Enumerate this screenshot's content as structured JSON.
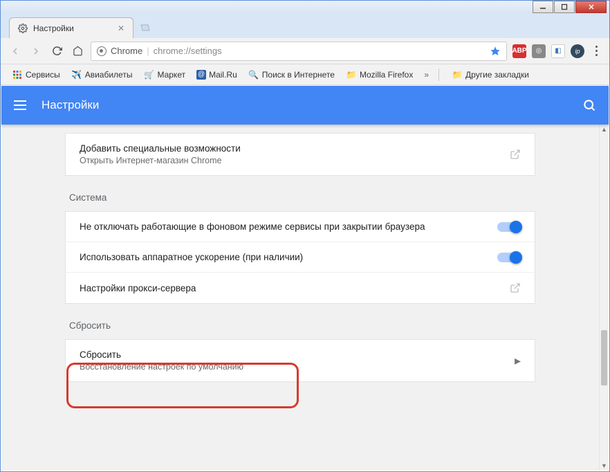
{
  "window": {
    "tab_title": "Настройки",
    "address_host": "Chrome",
    "address_path": "chrome://settings"
  },
  "bookmarks": {
    "items": [
      {
        "label": "Сервисы"
      },
      {
        "label": "Авиабилеты"
      },
      {
        "label": "Маркет"
      },
      {
        "label": "Mail.Ru"
      },
      {
        "label": "Поиск в Интернете"
      },
      {
        "label": "Mozilla Firefox"
      }
    ],
    "other_label": "Другие закладки"
  },
  "header": {
    "title": "Настройки"
  },
  "accessibility_card": {
    "title": "Добавить специальные возможности",
    "subtitle": "Открыть Интернет-магазин Chrome"
  },
  "system_section": {
    "label": "Система",
    "background_apps": "Не отключать работающие в фоновом режиме сервисы при закрытии браузера",
    "hw_accel": "Использовать аппаратное ускорение (при наличии)",
    "proxy": "Настройки прокси-сервера"
  },
  "reset_section": {
    "label": "Сбросить",
    "title": "Сбросить",
    "subtitle": "Восстановление настроек по умолчанию"
  }
}
